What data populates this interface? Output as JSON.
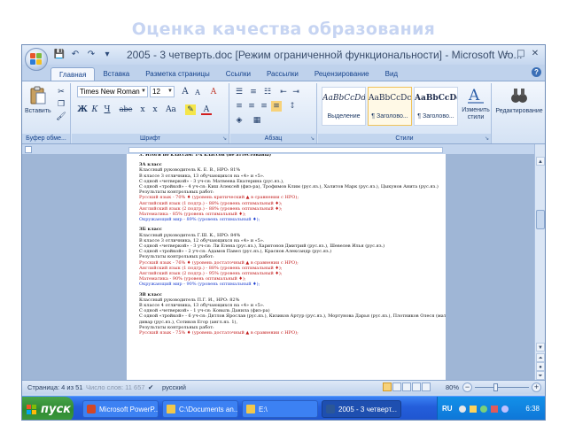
{
  "slide": {
    "title": "Оценка качества образования"
  },
  "window": {
    "title": "2005 - 3 четверть.doc [Режим ограниченной функциональности] - Microsoft Wo...",
    "controls": [
      "–",
      "□",
      "✕"
    ]
  },
  "qat": [
    "💾",
    "↶",
    "↷",
    "▾"
  ],
  "tabs": [
    "Главная",
    "Вставка",
    "Разметка страницы",
    "Ссылки",
    "Рассылки",
    "Рецензирование",
    "Вид"
  ],
  "ribbon": {
    "clipboard": {
      "paste": "Вставить",
      "label": "Буфер обме..."
    },
    "font": {
      "name": "Times New Roman",
      "size": "12",
      "grow": "A",
      "shrink": "A",
      "clear": "A",
      "bold": "Ж",
      "italic": "К",
      "underline": "Ч",
      "strike": "abe",
      "subscript": "x",
      "superscript": "x",
      "case": "Aa",
      "color": "A",
      "label": "Шрифт"
    },
    "paragraph": {
      "label": "Абзац"
    },
    "styles": {
      "items": [
        {
          "sample": "AaBbCcDd",
          "name": "Выделение"
        },
        {
          "sample": "AaBbCcDc",
          "name": "¶ Заголово..."
        },
        {
          "sample": "AaBbCcDc",
          "name": "¶ Заголово..."
        }
      ],
      "change": "Изменить стили",
      "label": "Стили"
    },
    "editing": {
      "label": "Редактирование"
    }
  },
  "document": {
    "lines": [
      {
        "t": "3. Итоги по классам: 1-х классов (не аттестованы)",
        "c": "b"
      },
      {
        "t": "3А класс",
        "c": "b gap"
      },
      {
        "t": "Классный руководитель К. Е. В., НРО: 81%",
        "c": ""
      },
      {
        "t": "В классе 3 отличника, 13 обучающихся на «4» и «5».",
        "c": ""
      },
      {
        "t": "С одной «четверкой» - 3 уч-ся: Матвеева Екатерина (рус.яз.),",
        "c": ""
      },
      {
        "t": "С одной «тройкой» - 4 уч-ся: Киш Алексей (физ-ра), Трофимов Клим (рус.яз.), Халитов Марк (рус.яз.), Цыкунов Анита (рус.яз.)",
        "c": ""
      },
      {
        "t": "Результаты контрольных работ:",
        "c": ""
      },
      {
        "t": "Русский язык - 70% ♦ (уровень критический ▲ в сравнении с НРО);",
        "c": "red"
      },
      {
        "t": "Английский язык (1 подгр.) - 88% (уровень оптимальный ♦);",
        "c": "red"
      },
      {
        "t": "Английский язык (2 подгр.) - 88% (уровень оптимальный ♦);",
        "c": "red"
      },
      {
        "t": "Математика - 85% (уровень оптимальный ♦);",
        "c": "red"
      },
      {
        "t": "Окружающий мир - 89% (уровень оптимальный ♦);",
        "c": "blue"
      },
      {
        "t": "3Б класс",
        "c": "b gap"
      },
      {
        "t": "Классный руководитель Г.Ш. К., НРО: 84%",
        "c": ""
      },
      {
        "t": "В классе 3 отличника, 12 обучающихся на «4» и «5».",
        "c": ""
      },
      {
        "t": "С одной «четверкой» - 3 уч-ся: Ли Елена (рус.яз.), Харитонов Дмитрий (рус.яз.), Шевелев Илья (рус.яз.)",
        "c": ""
      },
      {
        "t": "С одной «тройкой» - 2 уч-ся: Адамов Павел (рус.яз.), Краснов Александр (рус.яз.)",
        "c": ""
      },
      {
        "t": "Результаты контрольных работ:",
        "c": ""
      },
      {
        "t": "Русский язык - 76% ♦ (уровень достаточный ▲ в сравнении с НРО);",
        "c": "red"
      },
      {
        "t": "Английский язык (1 подгр.) - 88% (уровень оптимальный ♦);",
        "c": "red"
      },
      {
        "t": "Английский язык (2 подгр.) - 95% (уровень оптимальный ♦);",
        "c": "red"
      },
      {
        "t": "Математика - 90% (уровень оптимальный ♦);",
        "c": "red"
      },
      {
        "t": "Окружающий мир - 90% (уровень оптимальный ♦);",
        "c": "blue"
      },
      {
        "t": "3В класс",
        "c": "b gap"
      },
      {
        "t": "Классный руководитель П.Г. И., НРО: 82%",
        "c": ""
      },
      {
        "t": "В классе 4 отличника, 13 обучающихся на «4» и «5».",
        "c": ""
      },
      {
        "t": "С одной «четверкой» - 1 уч-ся: Ковыль Данила (физ-ра)",
        "c": ""
      },
      {
        "t": "С одной «тройкой» - 6 уч-ся: Дятлов Ярослав (рус.яз.), Кизиков Артур (рус.яз.), Мортунова Дарья (рус.яз.), Плотников Олеся (мат), Сабаева Ела-",
        "c": ""
      },
      {
        "t": "дивар (рус.яз.), Сотиков Егор (англ.яз. 1),",
        "c": ""
      },
      {
        "t": "Результаты контрольных работ:",
        "c": ""
      },
      {
        "t": "Русский язык - 75% ♦ (уровень достаточный ▲ в сравнении с НРО);",
        "c": "red"
      }
    ]
  },
  "status": {
    "page": "Страница: 4 из 51",
    "words": "Число слов: 11 657",
    "lang": "русский",
    "zoom": "80%",
    "zoom_value": 80
  },
  "taskbar": {
    "start": "пуск",
    "items": [
      {
        "label": "Microsoft PowerP...",
        "active": false
      },
      {
        "label": "C:\\Documents an...",
        "active": false
      },
      {
        "label": "E:\\",
        "active": false
      },
      {
        "label": "2005 - 3 четверт...",
        "active": true
      }
    ],
    "lang": "RU",
    "time": "6:38"
  },
  "colors": {
    "accent": "#15428b",
    "taskbar": "#245edb",
    "start": "#2f8a31",
    "title_text": "#c6d4f2"
  }
}
